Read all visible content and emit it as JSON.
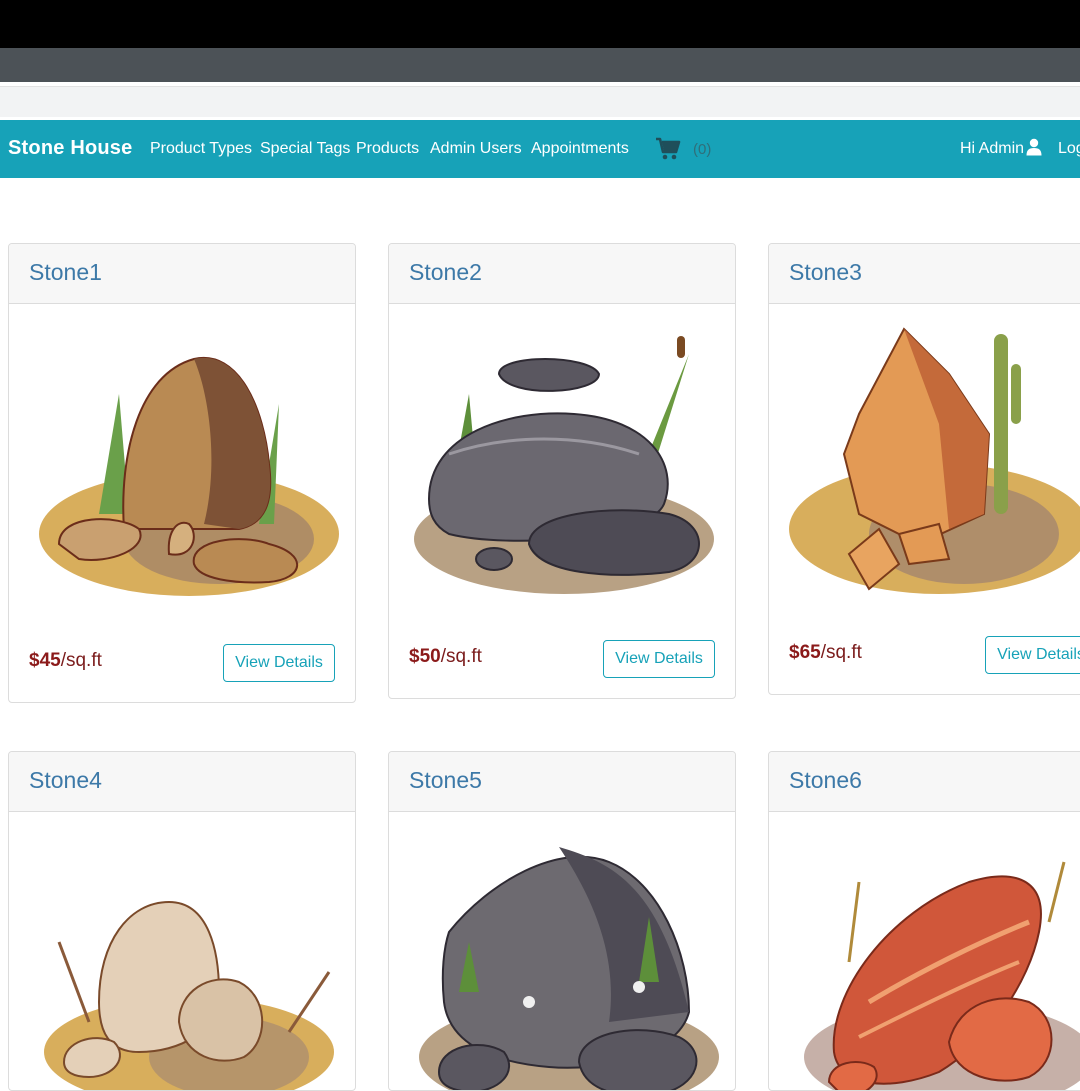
{
  "navbar": {
    "brand": "Stone House",
    "links": [
      "Product Types",
      "Special Tags",
      "Products",
      "Admin Users",
      "Appointments"
    ],
    "cart_count": "(0)",
    "greeting": "Hi Admin",
    "logout": "Log",
    "cart_icon": "cart-icon",
    "user_icon": "user-icon",
    "color": "#17a2b8"
  },
  "products": [
    {
      "name": "Stone1",
      "price_amount": "$45",
      "price_unit": "/sq.ft",
      "button": "View Details"
    },
    {
      "name": "Stone2",
      "price_amount": "$50",
      "price_unit": "/sq.ft",
      "button": "View Details"
    },
    {
      "name": "Stone3",
      "price_amount": "$65",
      "price_unit": "/sq.ft",
      "button": "View Details"
    },
    {
      "name": "Stone4"
    },
    {
      "name": "Stone5"
    },
    {
      "name": "Stone6"
    }
  ]
}
